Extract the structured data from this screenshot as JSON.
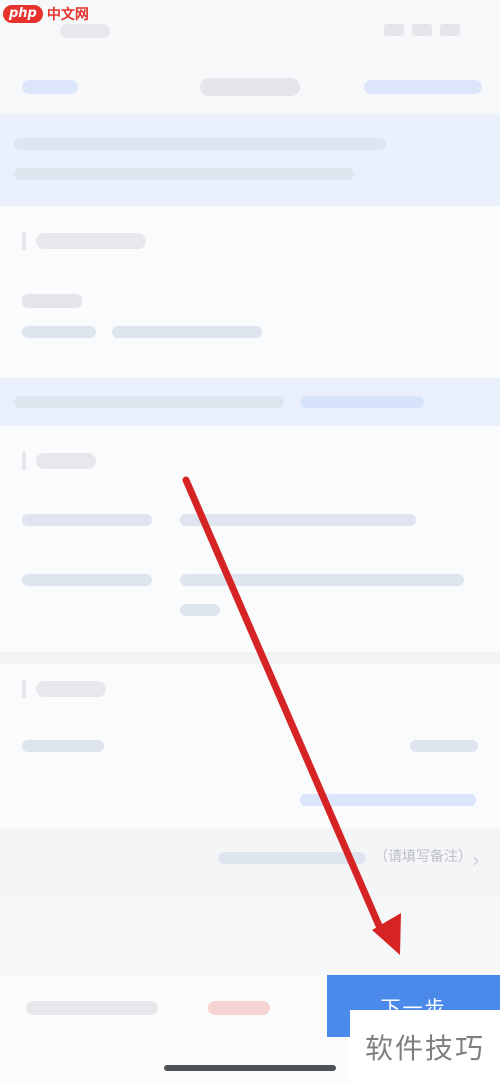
{
  "watermark_top": {
    "badge": "php",
    "text": "中文网"
  },
  "footer": {
    "note_suffix": "（请填写备注）"
  },
  "bottom_bar": {
    "next_label": "下一步"
  },
  "watermark_bottom": {
    "text": "软件技巧"
  },
  "colors": {
    "primary": "#4b89ea",
    "arrow": "#d62424",
    "notice_bg": "#eaf1fc",
    "price": "#f7d4d4"
  },
  "icons": {
    "chevron": "chevron-right-icon",
    "arrow": "red-arrow-annotation"
  }
}
